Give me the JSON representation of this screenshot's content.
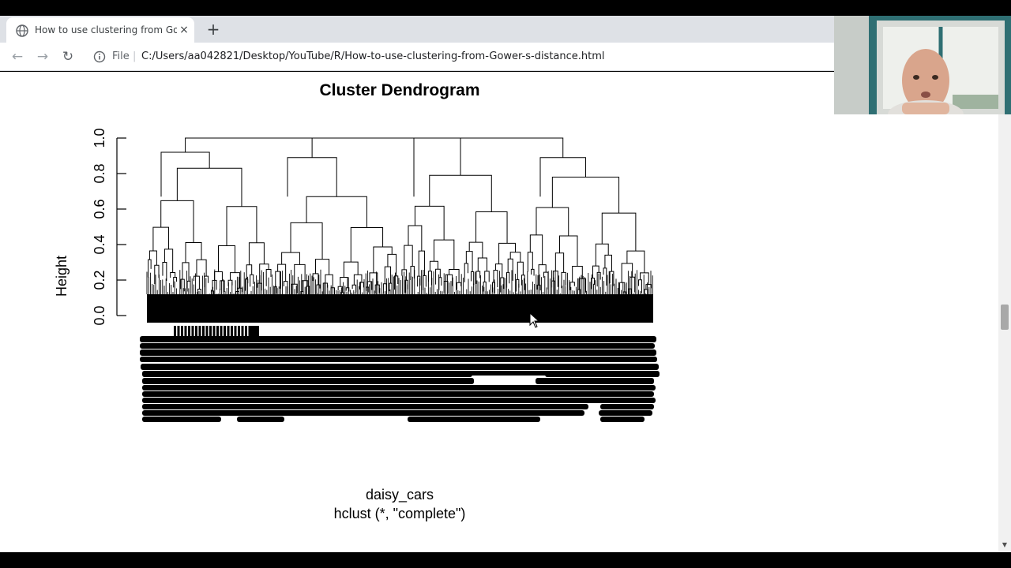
{
  "browser": {
    "tab": {
      "title": "How to use clustering from Gower-s-distance",
      "close_label": "×"
    },
    "new_tab_label": "+",
    "file_label": "File",
    "url": "C:/Users/aa042821/Desktop/YouTube/R/How-to-use-clustering-from-Gower-s-distance.html"
  },
  "chart_data": {
    "type": "dendrogram",
    "title": "Cluster Dendrogram",
    "ylabel": "Height",
    "xlabel": "daisy_cars",
    "sub": "hclust (*, \"complete\")",
    "ylim": [
      0,
      1.0
    ],
    "yticks": [
      "0.0",
      "0.2",
      "0.4",
      "0.6",
      "0.8",
      "1.0"
    ],
    "merges": {
      "root": 1.0,
      "level1": [
        0.92,
        0.89,
        1.0,
        0.89
      ],
      "level2": [
        0.83,
        0.67,
        0.79,
        0.78
      ]
    }
  },
  "colors": {
    "tab_strip": "#dee1e6",
    "page": "#ffffff",
    "ink": "#000000"
  }
}
